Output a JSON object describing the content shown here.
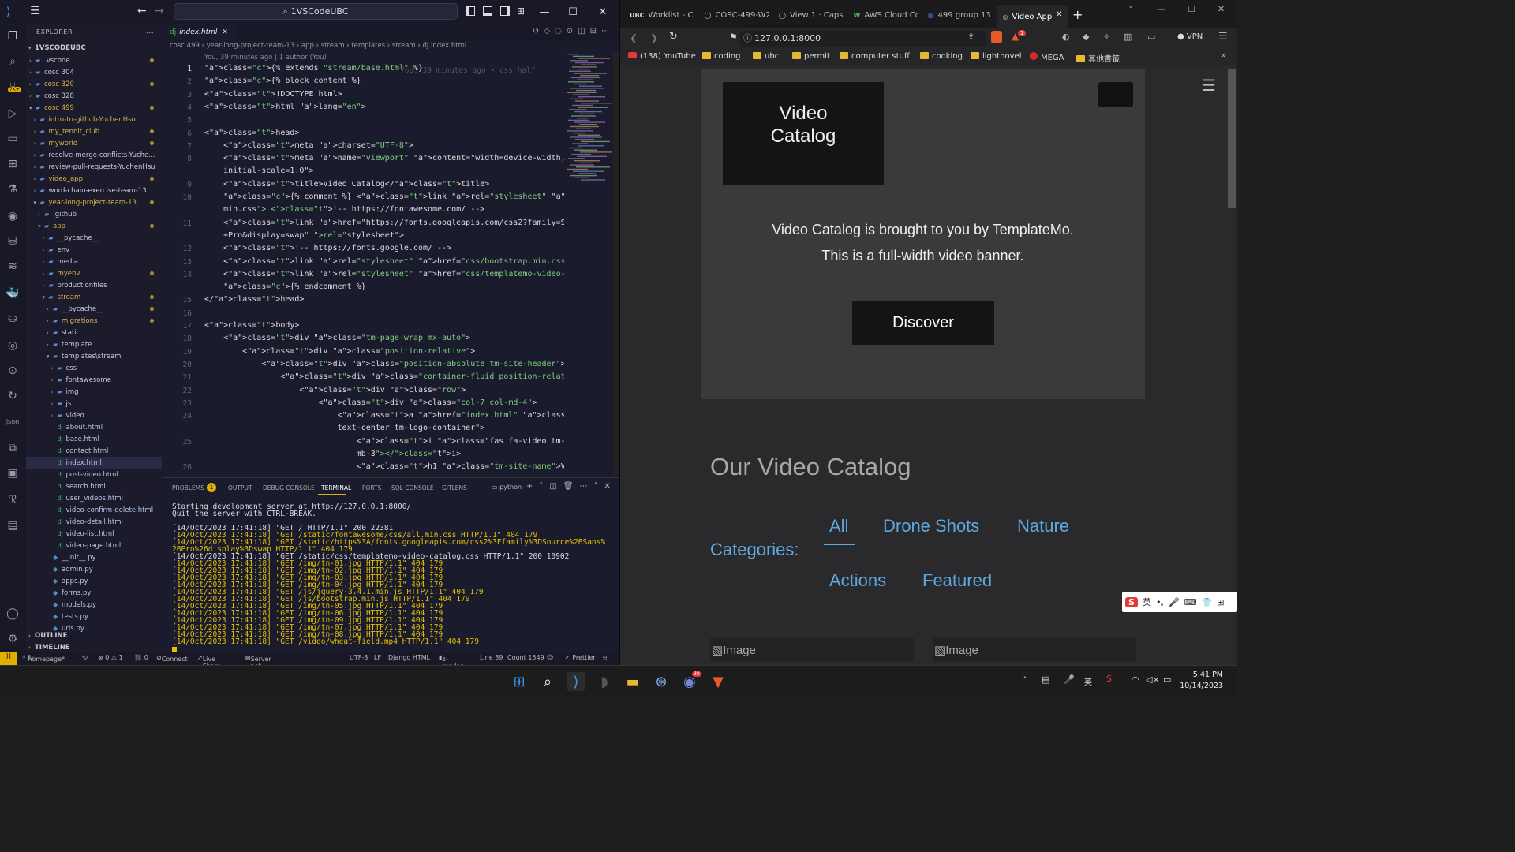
{
  "vscode": {
    "title": "1VSCodeUBC",
    "explorer_header": "EXPLORER",
    "workspace": "1VSCODEUBC",
    "tree": [
      {
        "label": ".vscode",
        "depth": 1,
        "type": "folder",
        "open": false,
        "dot": true
      },
      {
        "label": "cosc 304",
        "depth": 1,
        "type": "folder",
        "open": false
      },
      {
        "label": "cosc 320",
        "depth": 1,
        "type": "folder",
        "open": false,
        "dot": true
      },
      {
        "label": "cosc 328",
        "depth": 1,
        "type": "folder",
        "open": false
      },
      {
        "label": "cosc 499",
        "depth": 1,
        "type": "folder",
        "open": true,
        "dot": true
      },
      {
        "label": "intro-to-github-YuchenHsu",
        "depth": 2,
        "type": "folder",
        "open": false
      },
      {
        "label": "my_tennit_club",
        "depth": 2,
        "type": "folder",
        "open": false,
        "dot": true
      },
      {
        "label": "myworld",
        "depth": 2,
        "type": "folder",
        "open": false,
        "dot": true
      },
      {
        "label": "resolve-merge-conflicts-Yuche...",
        "depth": 2,
        "type": "folder",
        "open": false
      },
      {
        "label": "review-pull-requests-YuchenHsu",
        "depth": 2,
        "type": "folder",
        "open": false
      },
      {
        "label": "video_app",
        "depth": 2,
        "type": "folder",
        "open": false,
        "dot": true
      },
      {
        "label": "word-chain-exercise-team-13",
        "depth": 2,
        "type": "folder",
        "open": false
      },
      {
        "label": "year-long-project-team-13",
        "depth": 2,
        "type": "folder",
        "open": true,
        "dot": true
      },
      {
        "label": ".github",
        "depth": 3,
        "type": "folder",
        "open": false
      },
      {
        "label": "app",
        "depth": 3,
        "type": "folder",
        "open": true,
        "dot": true
      },
      {
        "label": "__pycache__",
        "depth": 4,
        "type": "folder",
        "open": false
      },
      {
        "label": "env",
        "depth": 4,
        "type": "folder",
        "open": false
      },
      {
        "label": "media",
        "depth": 4,
        "type": "folder",
        "open": false
      },
      {
        "label": "myenv",
        "depth": 4,
        "type": "folder",
        "open": false,
        "dot": true
      },
      {
        "label": "productionfiles",
        "depth": 4,
        "type": "folder",
        "open": false
      },
      {
        "label": "stream",
        "depth": 4,
        "type": "folder",
        "open": true,
        "dot": true
      },
      {
        "label": "__pycache__",
        "depth": 5,
        "type": "folder",
        "open": false,
        "dot": true
      },
      {
        "label": "migrations",
        "depth": 5,
        "type": "folder",
        "open": false,
        "dot": true
      },
      {
        "label": "static",
        "depth": 5,
        "type": "folder",
        "open": false
      },
      {
        "label": "template",
        "depth": 5,
        "type": "folder",
        "open": false
      },
      {
        "label": "templates\\stream",
        "depth": 5,
        "type": "folder",
        "open": true
      },
      {
        "label": "css",
        "depth": 6,
        "type": "folder",
        "open": false
      },
      {
        "label": "fontawesome",
        "depth": 6,
        "type": "folder",
        "open": false
      },
      {
        "label": "img",
        "depth": 6,
        "type": "folder",
        "open": false
      },
      {
        "label": "js",
        "depth": 6,
        "type": "folder",
        "open": false
      },
      {
        "label": "video",
        "depth": 6,
        "type": "folder",
        "open": false
      },
      {
        "label": "about.html",
        "depth": 6,
        "type": "file"
      },
      {
        "label": "base.html",
        "depth": 6,
        "type": "file"
      },
      {
        "label": "contact.html",
        "depth": 6,
        "type": "file"
      },
      {
        "label": "index.html",
        "depth": 6,
        "type": "file",
        "active": true
      },
      {
        "label": "post-video.html",
        "depth": 6,
        "type": "file"
      },
      {
        "label": "search.html",
        "depth": 6,
        "type": "file"
      },
      {
        "label": "user_videos.html",
        "depth": 6,
        "type": "file"
      },
      {
        "label": "video-confirm-delete.html",
        "depth": 6,
        "type": "file"
      },
      {
        "label": "video-detail.html",
        "depth": 6,
        "type": "file"
      },
      {
        "label": "video-list.html",
        "depth": 6,
        "type": "file"
      },
      {
        "label": "video-page.html",
        "depth": 6,
        "type": "file"
      },
      {
        "label": "__init__.py",
        "depth": 5,
        "type": "py"
      },
      {
        "label": "admin.py",
        "depth": 5,
        "type": "py"
      },
      {
        "label": "apps.py",
        "depth": 5,
        "type": "py"
      },
      {
        "label": "forms.py",
        "depth": 5,
        "type": "py"
      },
      {
        "label": "models.py",
        "depth": 5,
        "type": "py"
      },
      {
        "label": "tests.py",
        "depth": 5,
        "type": "py"
      },
      {
        "label": "urls.py",
        "depth": 5,
        "type": "py"
      }
    ],
    "outline": "OUTLINE",
    "timeline": "TIMELINE",
    "tab": "index.html",
    "breadcrumb": "cosc 499 › year-long-project-team-13 › app › stream › templates › stream › dj  index.html",
    "blame": "You, 39 minutes ago | 1 author (You)",
    "inline_blame": "You, 39 minutes ago • css half",
    "line_numbers": [
      "1",
      "2",
      "3",
      "4",
      "5",
      "6",
      "7",
      "8",
      "",
      "9",
      "10",
      "",
      "11",
      "",
      "12",
      "13",
      "14",
      "",
      "15",
      "16",
      "17",
      "18",
      "19",
      "20",
      "21",
      "22",
      "23",
      "24",
      "",
      "25",
      "",
      "26"
    ],
    "code": [
      "{% extends \"stream/base.html\" %}",
      "{% block content %}",
      "<!DOCTYPE html>",
      "<html lang=\"en\">",
      "",
      "<head>",
      "    <meta charset=\"UTF-8\">",
      "    <meta name=\"viewport\" content=\"width=device-width,",
      "    initial-scale=1.0\">",
      "    <title>Video Catalog</title>",
      "    {% comment %} <link rel=\"stylesheet\" href=\"fontawesome/css/all.",
      "    min.css\"> <!-- https://fontawesome.com/ -->",
      "    <link href=\"https://fonts.googleapis.com/css2?family=Source+Sans",
      "    +Pro&display=swap\" rel=\"stylesheet\">",
      "    <!-- https://fonts.google.com/ -->",
      "    <link rel=\"stylesheet\" href=\"css/bootstrap.min.css\">",
      "    <link rel=\"stylesheet\" href=\"css/templatemo-video-catalog.css\">",
      "    {% endcomment %}",
      "</head>",
      "",
      "<body>",
      "    <div class=\"tm-page-wrap mx-auto\">",
      "        <div class=\"position-relative\">",
      "            <div class=\"position-absolute tm-site-header\">",
      "                <div class=\"container-fluid position-relative\">",
      "                    <div class=\"row\">",
      "                        <div class=\"col-7 col-md-4\">",
      "                            <a href=\"index.html\" class=\"tm-bg-black",
      "                            text-center tm-logo-container\">",
      "                                <i class=\"fas fa-video tm-site-logo",
      "                                mb-3\"></i>",
      "                                <h1 class=\"tm-site-name\">Video"
    ],
    "panel_tabs": [
      "PROBLEMS",
      "OUTPUT",
      "DEBUG CONSOLE",
      "TERMINAL",
      "PORTS",
      "SQL CONSOLE",
      "GITLENS"
    ],
    "problems_count": "1",
    "terminal_shell": "python",
    "terminal": [
      {
        "t": "Starting development server at http://127.0.0.1:8000/",
        "c": ""
      },
      {
        "t": "Quit the server with CTRL-BREAK.",
        "c": ""
      },
      {
        "t": "",
        "c": ""
      },
      {
        "t": "[14/Oct/2023 17:41:18] \"GET / HTTP/1.1\" 200 22381",
        "c": ""
      },
      {
        "t": "[14/Oct/2023 17:41:18] \"GET /static/fontawesome/css/all.min.css HTTP/1.1\" 404 179",
        "c": "y"
      },
      {
        "t": "[14/Oct/2023 17:41:18] \"GET /static/https%3A/fonts.googleapis.com/css2%3Ffamily%3DSource%2BSans%",
        "c": "y"
      },
      {
        "t": "2BPro%26display%3Dswap HTTP/1.1\" 404 179",
        "c": "y"
      },
      {
        "t": "[14/Oct/2023 17:41:18] \"GET /static/css/templatemo-video-catalog.css HTTP/1.1\" 200 10902",
        "c": ""
      },
      {
        "t": "[14/Oct/2023 17:41:18] \"GET /img/tn-01.jpg HTTP/1.1\" 404 179",
        "c": "y"
      },
      {
        "t": "[14/Oct/2023 17:41:18] \"GET /img/tn-02.jpg HTTP/1.1\" 404 179",
        "c": "y"
      },
      {
        "t": "[14/Oct/2023 17:41:18] \"GET /img/tn-03.jpg HTTP/1.1\" 404 179",
        "c": "y"
      },
      {
        "t": "[14/Oct/2023 17:41:18] \"GET /img/tn-04.jpg HTTP/1.1\" 404 179",
        "c": "y"
      },
      {
        "t": "[14/Oct/2023 17:41:18] \"GET /js/jquery-3.4.1.min.js HTTP/1.1\" 404 179",
        "c": "y"
      },
      {
        "t": "[14/Oct/2023 17:41:18] \"GET /js/bootstrap.min.js HTTP/1.1\" 404 179",
        "c": "y"
      },
      {
        "t": "[14/Oct/2023 17:41:18] \"GET /img/tn-05.jpg HTTP/1.1\" 404 179",
        "c": "y"
      },
      {
        "t": "[14/Oct/2023 17:41:18] \"GET /img/tn-06.jpg HTTP/1.1\" 404 179",
        "c": "y"
      },
      {
        "t": "[14/Oct/2023 17:41:18] \"GET /img/tn-09.jpg HTTP/1.1\" 404 179",
        "c": "y"
      },
      {
        "t": "[14/Oct/2023 17:41:18] \"GET /img/tn-07.jpg HTTP/1.1\" 404 179",
        "c": "y"
      },
      {
        "t": "[14/Oct/2023 17:41:18] \"GET /img/tn-08.jpg HTTP/1.1\" 404 179",
        "c": "y"
      },
      {
        "t": "[14/Oct/2023 17:41:18] \"GET /video/wheat-field.mp4 HTTP/1.1\" 404 179",
        "c": "y"
      }
    ],
    "status": {
      "branch": "homepage*",
      "errors": "⊗ 0 ⚠ 1",
      "ports": "⛓ 0",
      "connect": "Connect",
      "live_share": "Live Share",
      "server": "Server not selected",
      "encoding": "UTF-8",
      "eol": "LF",
      "language": "Django HTML",
      "zreader": "z-reader",
      "line": "Line 39",
      "count": "Count 1549",
      "prettier": "✓ Prettier"
    }
  },
  "browser": {
    "tabs": [
      "Worklist - Cour",
      "COSC-499-W2",
      "View 1 · Caps",
      "AWS Cloud Co",
      "499 group 13",
      "Video App"
    ],
    "url": "127.0.0.1:8000",
    "bookmarks": [
      "(138) YouTube",
      "coding",
      "ubc",
      "permit",
      "computer stuff",
      "cooking",
      "lightnovel",
      "MEGA",
      "其他書籤"
    ],
    "vpn": "VPN",
    "shield_badge": "1"
  },
  "site": {
    "logo": "Video Catalog",
    "banner_line1": "Video Catalog is brought to you by TemplateMo.",
    "banner_line2": "This is a full-width video banner.",
    "discover": "Discover",
    "catalog_title": "Our Video Catalog",
    "categories_label": "Categories:",
    "categories": [
      "All",
      "Drone Shots",
      "Nature",
      "Actions",
      "Featured"
    ],
    "img_alt": "Image"
  },
  "ime": {
    "label": "英"
  },
  "taskbar": {
    "ime": "英",
    "time": "5:41 PM",
    "date": "10/14/2023",
    "discord_badge": "30"
  }
}
